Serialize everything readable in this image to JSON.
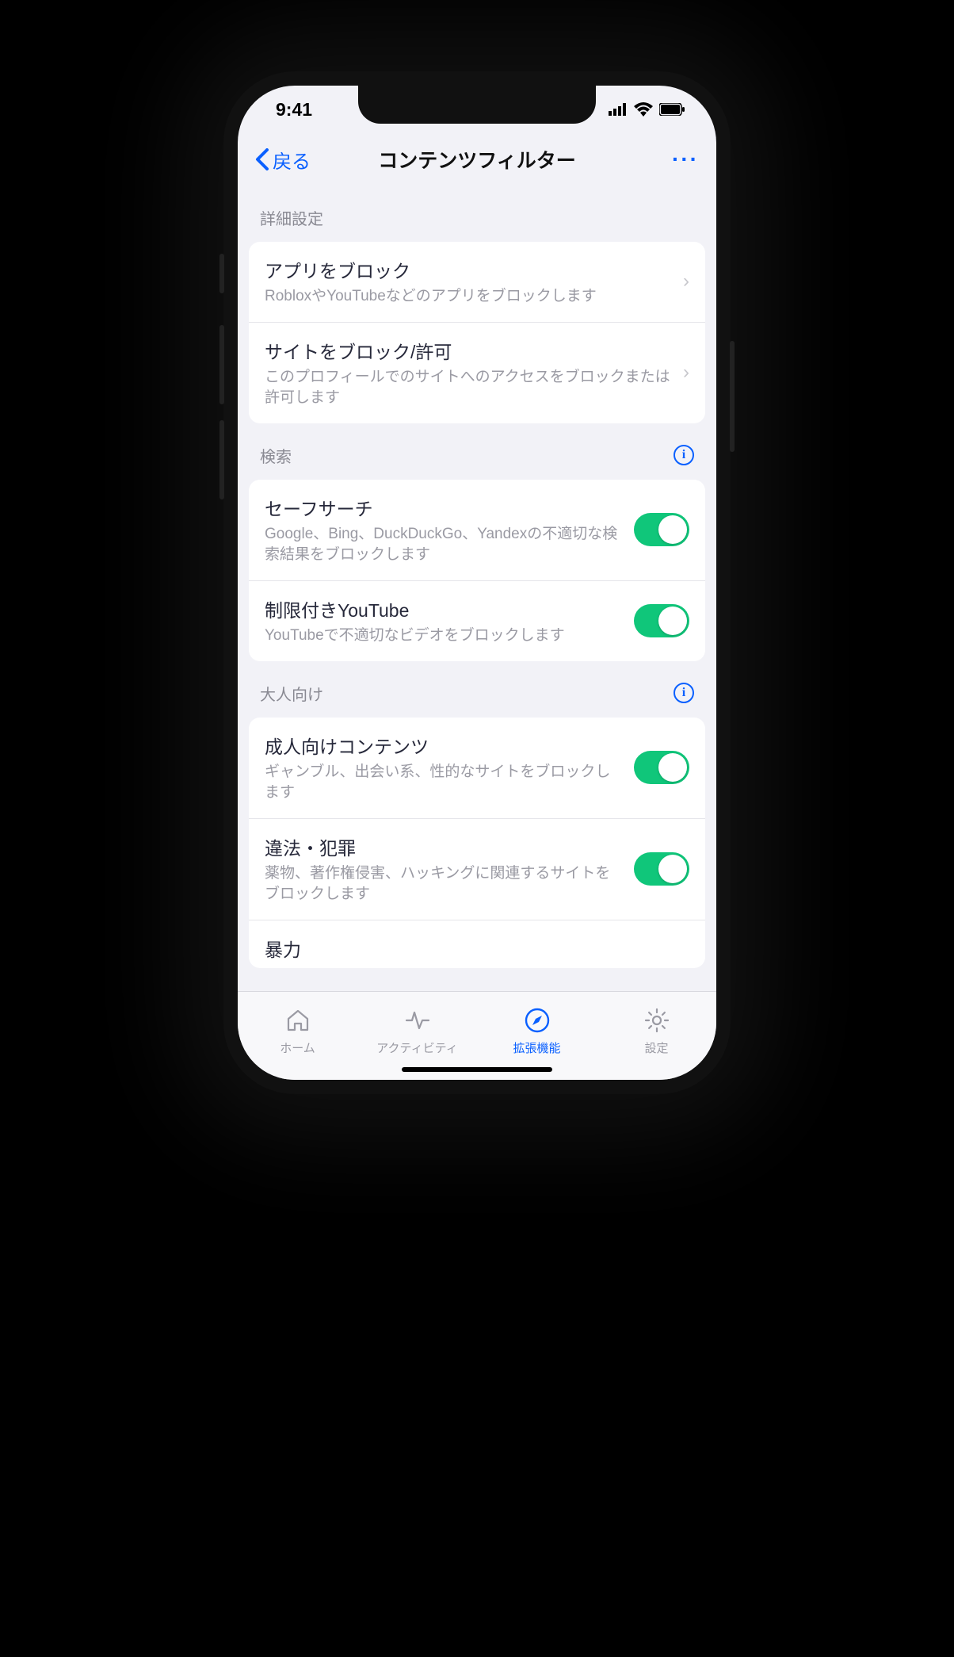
{
  "statusbar": {
    "time": "9:41"
  },
  "navbar": {
    "back_label": "戻る",
    "title": "コンテンツフィルター"
  },
  "sections": {
    "advanced": {
      "header": "詳細設定",
      "rows": [
        {
          "title": "アプリをブロック",
          "sub": "RobloxやYouTubeなどのアプリをブロックします"
        },
        {
          "title": "サイトをブロック/許可",
          "sub": "このプロフィールでのサイトへのアクセスをブロックまたは許可します"
        }
      ]
    },
    "search": {
      "header": "検索",
      "rows": [
        {
          "title": "セーフサーチ",
          "sub": "Google、Bing、DuckDuckGo、Yandexの不適切な検索結果をブロックします",
          "on": true
        },
        {
          "title": "制限付きYouTube",
          "sub": "YouTubeで不適切なビデオをブロックします",
          "on": true
        }
      ]
    },
    "adult": {
      "header": "大人向け",
      "rows": [
        {
          "title": "成人向けコンテンツ",
          "sub": "ギャンブル、出会い系、性的なサイトをブロックします",
          "on": true
        },
        {
          "title": "違法・犯罪",
          "sub": "薬物、著作権侵害、ハッキングに関連するサイトをブロックします",
          "on": true
        },
        {
          "title": "暴力",
          "sub": "",
          "on": true
        }
      ]
    }
  },
  "tabs": [
    {
      "label": "ホーム"
    },
    {
      "label": "アクティビティ"
    },
    {
      "label": "拡張機能"
    },
    {
      "label": "設定"
    }
  ]
}
